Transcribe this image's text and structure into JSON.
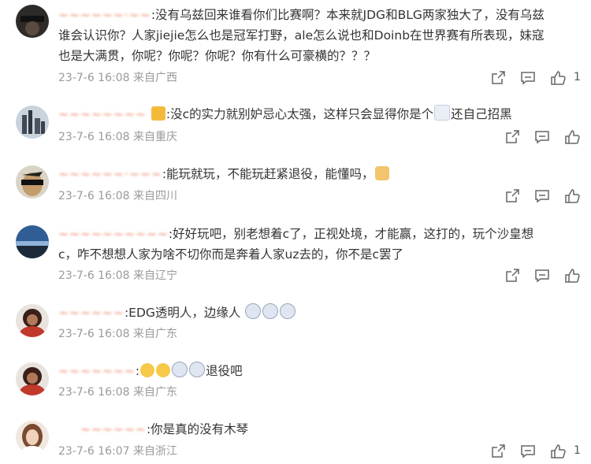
{
  "comments": [
    {
      "username": "~~~~~~·~~",
      "text": ":没有乌兹回来谁看你们比赛啊？本来就JDG和BLG两家独大了，没有乌兹谁会认识你？人家jiejie怎么也是冠军打野，ale怎么说也和Doinb在世界赛有所表现，妹寇也是大满贯，你呢？你呢？你呢？你有什么可豪横的？？？",
      "time": "23-7-6 16:08",
      "location": "来自广西",
      "likes": "1",
      "avatar": "dark-shades"
    },
    {
      "username": "~~~~~~~~",
      "text": ":没c的实力就别妒忌心太强，这样只会显得你是个",
      "text_after": "还自己招黑",
      "time": "23-7-6 16:08",
      "location": "来自重庆",
      "likes": "",
      "avatar": "city-skyline"
    },
    {
      "username": "~~~~~~·~~~",
      "text": ":能玩就玩，不能玩赶紧退役，能懂吗，",
      "time": "23-7-6 16:08",
      "location": "来自四川",
      "likes": "",
      "avatar": "cartoon-face"
    },
    {
      "username": "~~~~~~~~~~",
      "text": ":好好玩吧，别老想着c了，正视处境，才能赢，这打的，玩个沙皇想c，咋不想想人家为啥不切你而是奔着人家uz去的，你不是c罢了",
      "time": "23-7-6 16:08",
      "location": "来自辽宁",
      "likes": "",
      "avatar": "sunset-sky"
    },
    {
      "username": "~~~~~~",
      "text": ":EDG透明人，边缘人",
      "time": "23-7-6 16:08",
      "location": "来自广东",
      "likes": "",
      "avatar": "red-portrait"
    },
    {
      "username": "~~~~~~~",
      "text": "退役吧",
      "time": "23-7-6 16:08",
      "location": "来自广东",
      "likes": "",
      "avatar": "red-portrait"
    },
    {
      "username": "~~~~~~",
      "text": ":你是真的没有木琴",
      "time": "23-7-6 16:07",
      "location": "来自浙江",
      "likes": "1",
      "avatar": "woman-portrait"
    }
  ]
}
